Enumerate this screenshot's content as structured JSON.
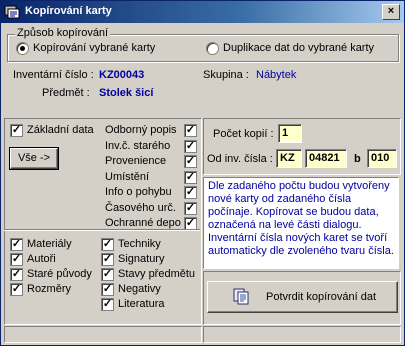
{
  "window": {
    "title": "Kopírování karty",
    "close_glyph": "×"
  },
  "mode_group": {
    "legend": "Způsob kopírování",
    "option_copy": "Kopírování vybrané karty",
    "option_duplicate": "Duplikace dat do vybrané karty",
    "selected": "copy"
  },
  "record": {
    "inventory_label": "Inventární číslo :",
    "inventory_value": "KZ00043",
    "group_label": "Skupina :",
    "group_value": "Nábytek",
    "subject_label": "Předmět :",
    "subject_value": "Stolek šicí"
  },
  "sections": {
    "basic_data": {
      "label": "Základní data",
      "checked": true
    },
    "all_button": "Vše ->",
    "right_items": [
      {
        "label": "Odborný popis",
        "checked": true
      },
      {
        "label": "Inv.č. starého",
        "checked": true
      },
      {
        "label": "Provenience",
        "checked": true
      },
      {
        "label": "Umístění",
        "checked": true
      },
      {
        "label": "Info o pohybu",
        "checked": true
      },
      {
        "label": "Časového urč.",
        "checked": true
      },
      {
        "label": "Ochranné depo",
        "checked": true
      }
    ],
    "bottom_left": [
      {
        "label": "Materiály",
        "checked": true
      },
      {
        "label": "Autoři",
        "checked": true
      },
      {
        "label": "Staré původy",
        "checked": true
      },
      {
        "label": "Rozměry",
        "checked": true
      }
    ],
    "bottom_right": [
      {
        "label": "Techniky",
        "checked": true
      },
      {
        "label": "Signatury",
        "checked": true
      },
      {
        "label": "Stavy předmětu",
        "checked": true
      },
      {
        "label": "Negativy",
        "checked": true
      },
      {
        "label": "Literatura",
        "checked": true
      }
    ]
  },
  "copy_params": {
    "count_label": "Počet kopií :",
    "count_value": "1",
    "from_label": "Od inv. čísla :",
    "prefix": "KZ",
    "number": "04821",
    "b_label": "b",
    "suffix": "010"
  },
  "info_text": "Dle zadaného počtu budou vytvořeny nové karty od zadaného čísla počínaje. Kopírovat se budou data, označená na levé části dialogu. Inventární čísla nových karet se tvoří automaticky dle zvoleného tvaru čísla.",
  "confirm_button": "Potvrdit kopírování dat",
  "check_glyph": "✓",
  "colors": {
    "title_gradient_start": "#0a246a",
    "label_blue": "#0000a0",
    "field_bg": "#ffffcc",
    "dialog_bg": "#d4d0c8"
  }
}
